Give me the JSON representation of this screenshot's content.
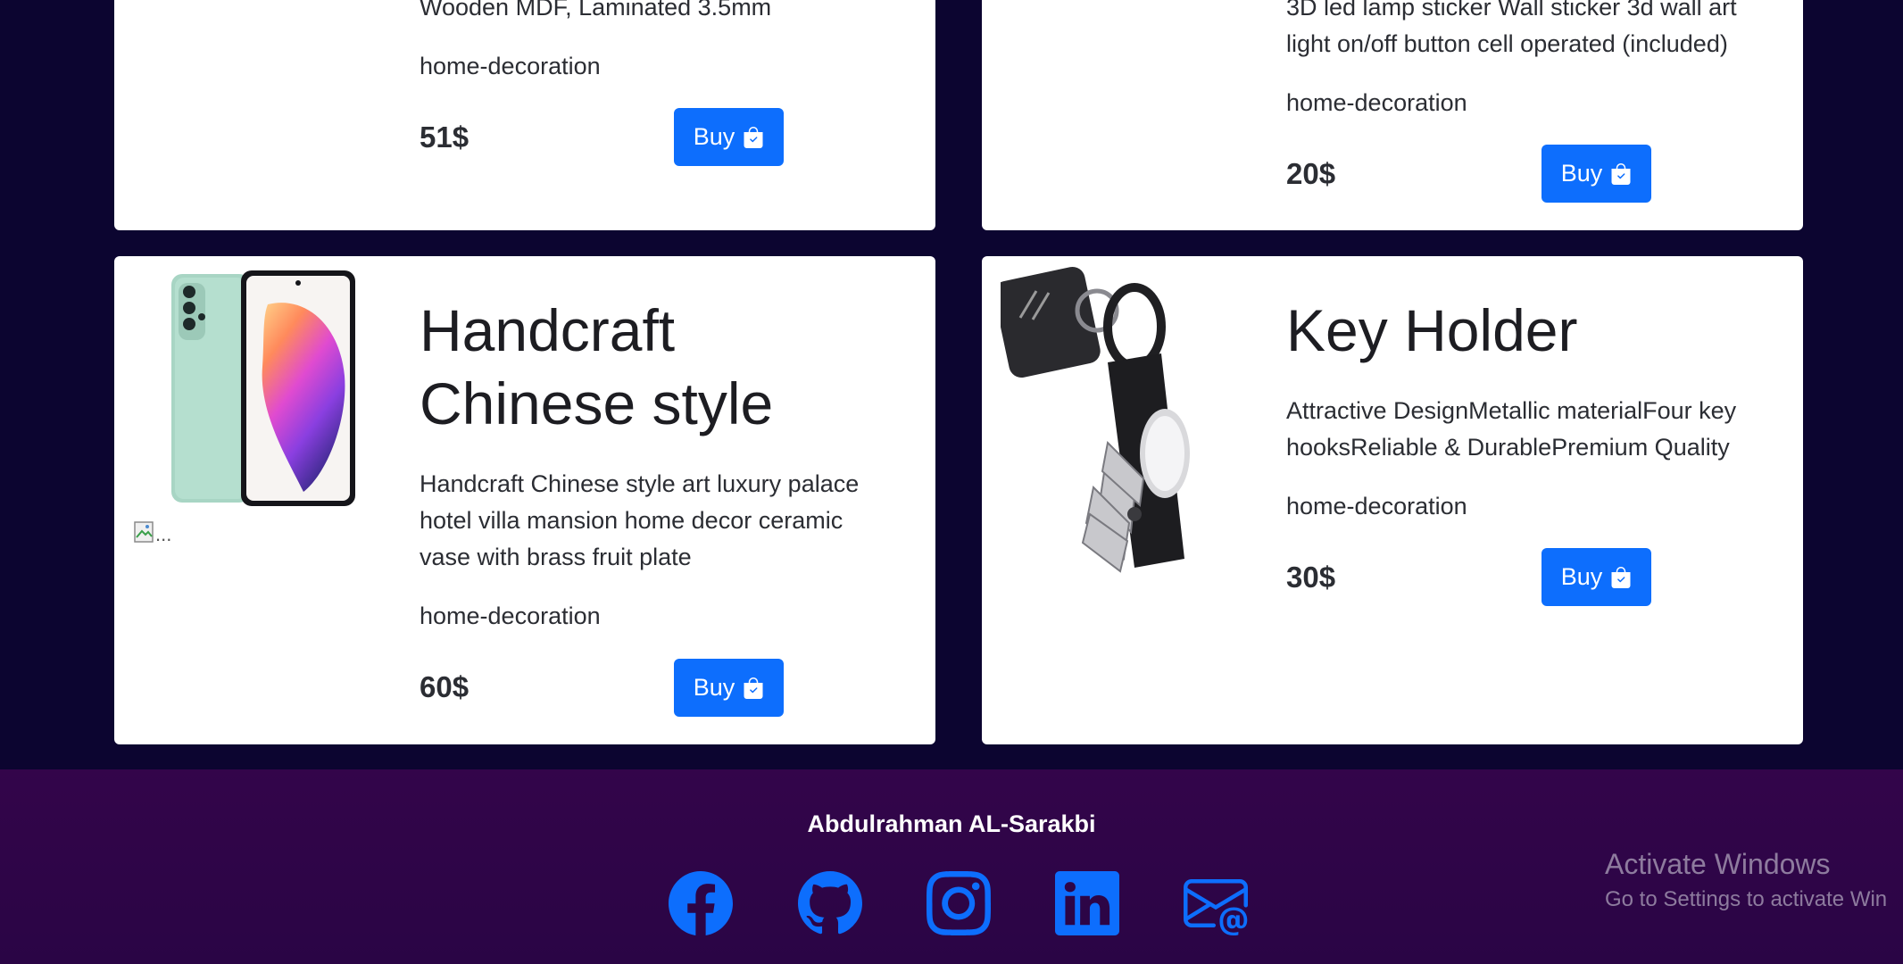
{
  "products": [
    {
      "title": "",
      "desc_tail": "Wooden MDF, Laminated 3.5mm",
      "category": "home-decoration",
      "price": "51$",
      "buy_label": "Buy"
    },
    {
      "title": "",
      "desc_lines": [
        "3D led lamp sticker Wall sticker 3d wall art",
        "light on/off button cell operated (included)"
      ],
      "category": "home-decoration",
      "price": "20$",
      "buy_label": "Buy"
    },
    {
      "title_lines": [
        "Handcraft",
        "Chinese style"
      ],
      "desc_lines": [
        "Handcraft Chinese style art luxury palace",
        "hotel villa mansion home decor ceramic",
        "vase with brass fruit plate"
      ],
      "category": "home-decoration",
      "price": "60$",
      "buy_label": "Buy",
      "broken_image_alt": "..."
    },
    {
      "title": "Key Holder",
      "desc_lines": [
        "Attractive DesignMetallic materialFour key",
        "hooksReliable & DurablePremium Quality"
      ],
      "category": "home-decoration",
      "price": "30$",
      "buy_label": "Buy"
    }
  ],
  "footer": {
    "author": "Abdulrahman AL-Sarakbi",
    "social_icons": [
      "facebook-icon",
      "github-icon",
      "instagram-icon",
      "linkedin-icon",
      "email-icon"
    ],
    "icon_color": "#0d6efd"
  },
  "watermark": {
    "line1": "Activate Windows",
    "line2": "Go to Settings to activate Win"
  },
  "colors": {
    "page_bg": "#0c0530",
    "footer_bg": "#33054a",
    "accent": "#0d6efd"
  }
}
